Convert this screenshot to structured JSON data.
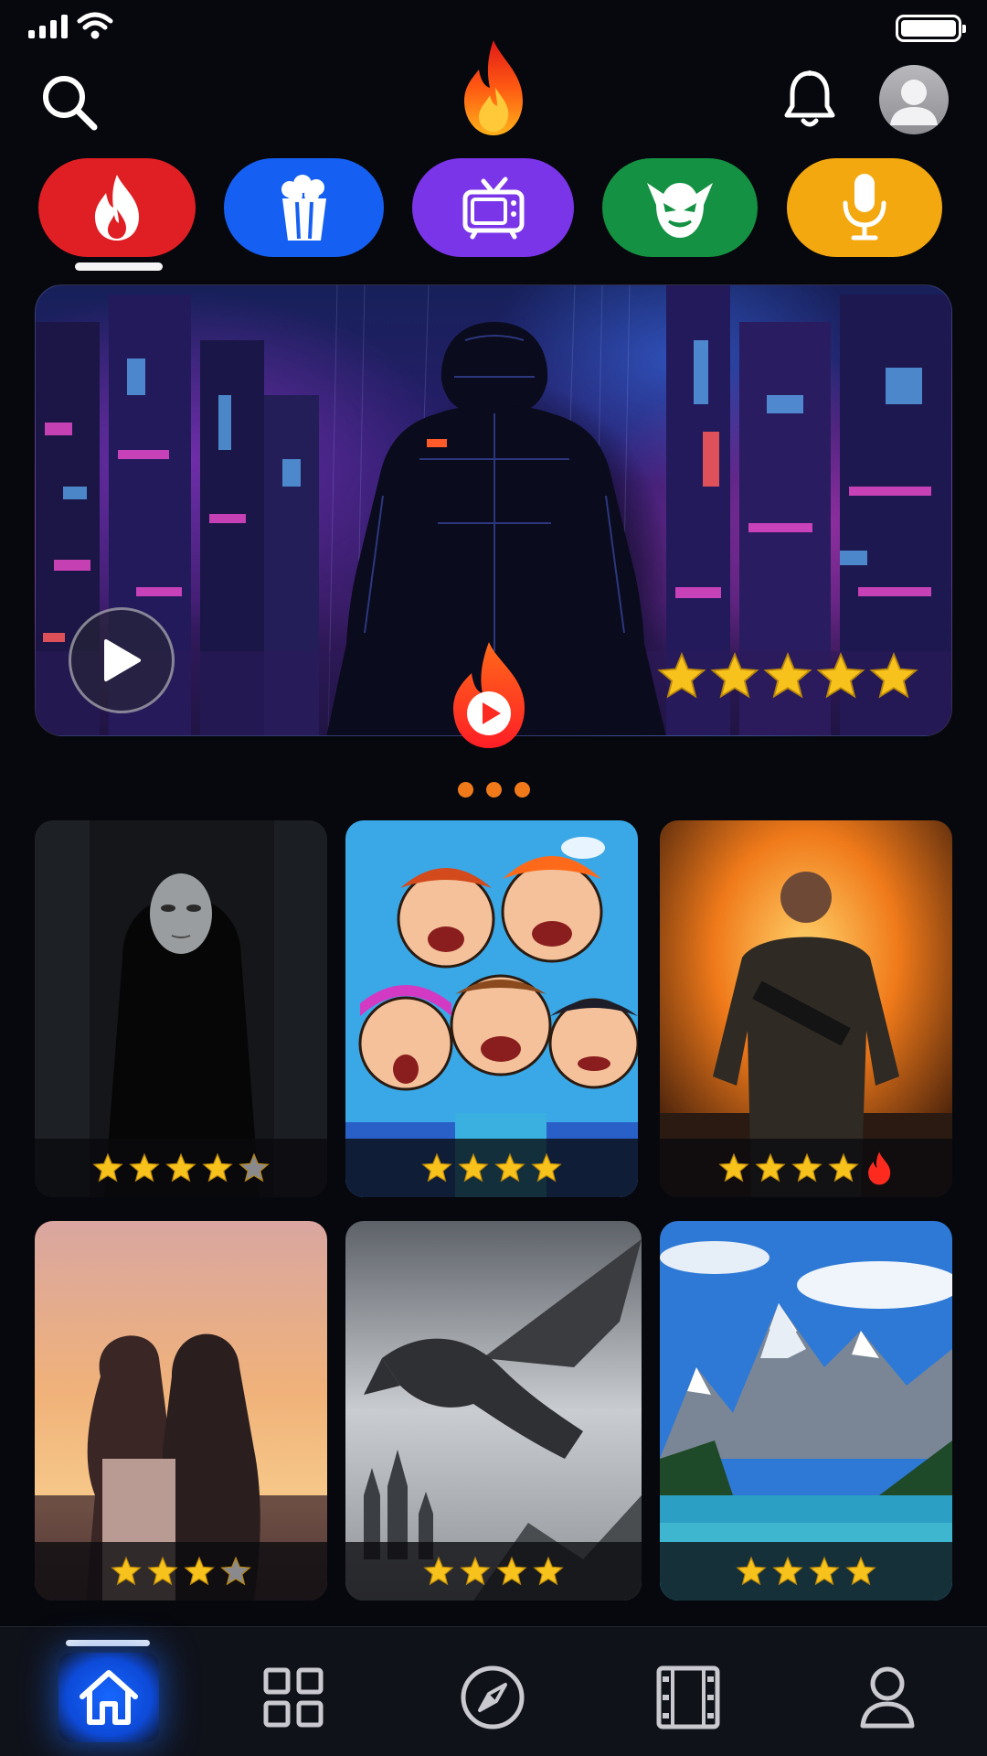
{
  "status_bar": {
    "signal_icon": "cellular-signal-icon",
    "wifi_icon": "wifi-icon",
    "battery_icon": "battery-full-icon",
    "battery_level": 1.0
  },
  "header": {
    "search_icon": "search-icon",
    "logo_icon": "flame-logo-icon",
    "notifications_icon": "bell-icon",
    "profile_icon": "avatar-icon"
  },
  "categories": [
    {
      "icon": "flame-icon",
      "color": "#e01f25",
      "active": true
    },
    {
      "icon": "popcorn-icon",
      "color": "#1560f2",
      "active": false
    },
    {
      "icon": "tv-icon",
      "color": "#7a35e8",
      "active": false
    },
    {
      "icon": "monster-mask-icon",
      "color": "#149142",
      "active": false
    },
    {
      "icon": "microphone-icon",
      "color": "#f4a80f",
      "active": false
    }
  ],
  "hero": {
    "play_icon": "play-icon",
    "rating": 5,
    "rating_max": 5,
    "badge_icon": "flame-play-icon"
  },
  "carousel": {
    "pages": 3
  },
  "grid": [
    {
      "art": "hooded-masked-figure",
      "rating": 4,
      "rating_max": 5,
      "hot": false
    },
    {
      "art": "cartoon-group",
      "rating": 4,
      "rating_max": 4,
      "hot": false
    },
    {
      "art": "soldier-explosion",
      "rating": 4,
      "rating_max": 4,
      "hot": true
    },
    {
      "art": "couple-sunset",
      "rating": 3,
      "rating_max": 4,
      "hot": false
    },
    {
      "art": "dragon-castle",
      "rating": 4,
      "rating_max": 4,
      "hot": false
    },
    {
      "art": "mountain-lake",
      "rating": 4,
      "rating_max": 4,
      "hot": false
    }
  ],
  "bottom_nav": [
    {
      "icon": "home-icon",
      "active": true
    },
    {
      "icon": "grid-icon",
      "active": false
    },
    {
      "icon": "compass-icon",
      "active": false
    },
    {
      "icon": "film-icon",
      "active": false
    },
    {
      "icon": "profile-icon",
      "active": false
    }
  ],
  "colors": {
    "background": "#07080d",
    "accent_orange": "#f07a1a",
    "star_gold": "#f7c21b",
    "star_empty": "#8a8a8e",
    "nav_active": "#1767ff"
  }
}
